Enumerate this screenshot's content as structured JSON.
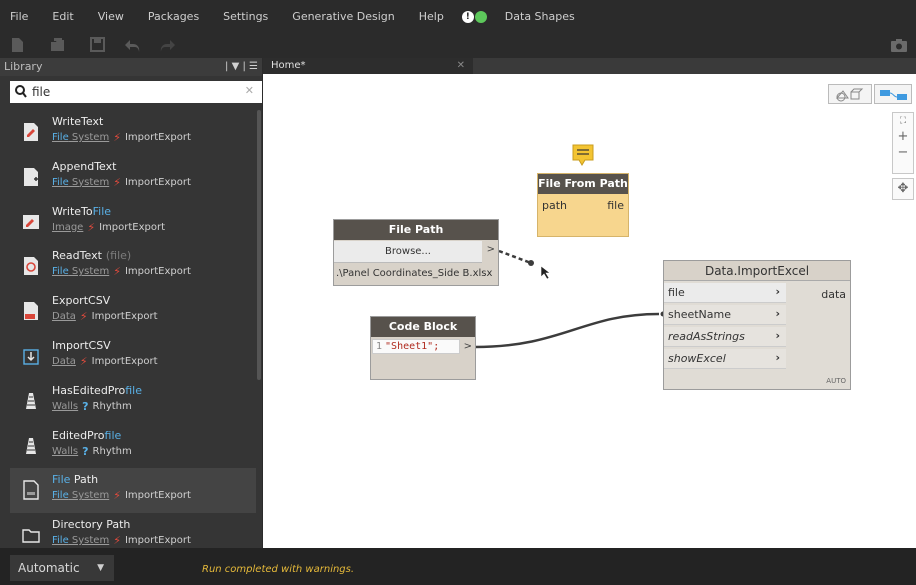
{
  "menu": [
    "File",
    "Edit",
    "View",
    "Packages",
    "Settings",
    "Generative Design",
    "Help",
    "Data Shapes"
  ],
  "notifications": {
    "warning_color": "#ffffff",
    "ok_color": "#5dc85b"
  },
  "library": {
    "title": "Library",
    "search_value": "file",
    "items": [
      {
        "prefix": "WriteText",
        "match": "",
        "hint": "",
        "category_match": "File",
        "category_rest": " System",
        "glyph": "⚡",
        "group": "ImportExport",
        "icon": "write-text-icon"
      },
      {
        "prefix": "AppendText",
        "match": "",
        "hint": "",
        "category_match": "File",
        "category_rest": " System",
        "glyph": "⚡",
        "group": "ImportExport",
        "icon": "append-text-icon"
      },
      {
        "prefix": "WriteTo",
        "match": "File",
        "hint": "",
        "category_match": "",
        "category_rest": "Image",
        "glyph": "⚡",
        "group": "ImportExport",
        "icon": "write-to-file-icon"
      },
      {
        "prefix": "ReadText",
        "match": "",
        "hint": "(file)",
        "category_match": "File",
        "category_rest": " System",
        "glyph": "⚡",
        "group": "ImportExport",
        "icon": "read-text-icon"
      },
      {
        "prefix": "ExportCSV",
        "match": "",
        "hint": "",
        "category_match": "",
        "category_rest": "Data",
        "glyph": "⚡",
        "group": "ImportExport",
        "icon": "export-csv-icon"
      },
      {
        "prefix": "ImportCSV",
        "match": "",
        "hint": "",
        "category_match": "",
        "category_rest": "Data",
        "glyph": "⚡",
        "group": "ImportExport",
        "icon": "import-csv-icon"
      },
      {
        "prefix": "HasEditedPro",
        "match": "file",
        "hint": "",
        "category_match": "",
        "category_rest": "Walls",
        "glyph": "?",
        "group": "Rhythm",
        "icon": "profile-icon"
      },
      {
        "prefix": "EditedPro",
        "match": "file",
        "hint": "",
        "category_match": "",
        "category_rest": "Walls",
        "glyph": "?",
        "group": "Rhythm",
        "icon": "profile-icon"
      },
      {
        "prefix": "",
        "match": "File",
        "suffix": " Path",
        "hint": "",
        "category_match": "File",
        "category_rest": " System",
        "glyph": "⚡",
        "group": "ImportExport",
        "icon": "file-path-icon"
      },
      {
        "prefix": "Directory Path",
        "match": "",
        "hint": "",
        "category_match": "File",
        "category_rest": " System",
        "glyph": "⚡",
        "group": "ImportExport",
        "icon": "directory-path-icon"
      }
    ]
  },
  "tab": {
    "label": "Home*"
  },
  "nodes": {
    "file_from_path": {
      "title": "File From Path",
      "input": "path",
      "output": "file"
    },
    "file_path": {
      "title": "File Path",
      "button": "Browse...",
      "value": ".\\Panel Coordinates_Side B.xlsx"
    },
    "code_block": {
      "title": "Code Block",
      "line_no": "1",
      "code": "\"Sheet1\";"
    },
    "import_excel": {
      "title": "Data.ImportExcel",
      "inputs": [
        "file",
        "sheetName",
        "readAsStrings",
        "showExcel"
      ],
      "output": "data",
      "lacing": "AUTO"
    }
  },
  "status": {
    "run_mode": "Automatic",
    "message": "Run completed with warnings."
  }
}
